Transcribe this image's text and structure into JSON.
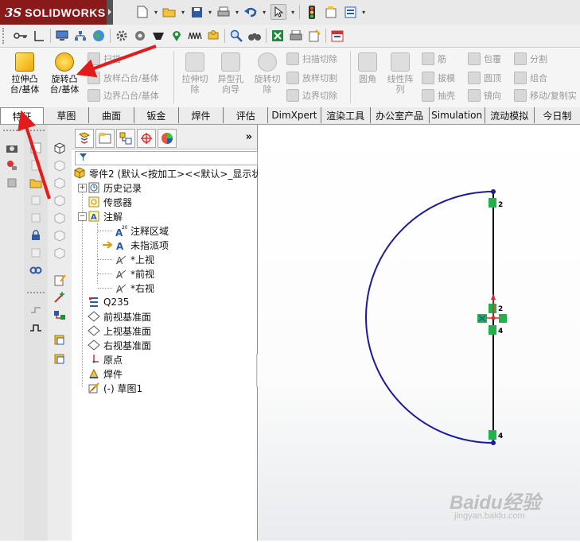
{
  "app": {
    "brand_prefix": "3S",
    "brand": "SOLIDWORKS"
  },
  "quick_access": [
    {
      "icon": "new-document-icon"
    },
    {
      "icon": "open-folder-icon"
    },
    {
      "icon": "save-icon"
    },
    {
      "icon": "print-icon"
    },
    {
      "icon": "undo-icon"
    },
    {
      "icon": "select-arrow-icon"
    },
    {
      "icon": "rebuild-traffic-light-icon"
    },
    {
      "icon": "file-properties-icon"
    },
    {
      "icon": "options-icon"
    }
  ],
  "ribbon": {
    "extrude_boss": "拉伸凸\n台/基体",
    "revolve_boss": "旋转凸\n台/基体",
    "sweep": "扫描",
    "loft_boss": "放样凸台/基体",
    "boundary_boss": "边界凸台/基体",
    "extrude_cut": "拉伸切\n除",
    "hole_wizard": "异型孔\n向导",
    "revolve_cut": "旋转切\n除",
    "sweep_cut": "扫描切除",
    "loft_cut": "放样切割",
    "boundary_cut": "边界切除",
    "fillet": "圆角",
    "linear_pattern": "线性阵\n列",
    "rib": "筋",
    "draft": "拔模",
    "shell": "抽壳",
    "wrap": "包覆",
    "dome": "圆顶",
    "mirror": "镜向",
    "split": "分割",
    "combine": "组合",
    "move_copy": "移动/复制实"
  },
  "tabs": [
    "特征",
    "草图",
    "曲面",
    "钣金",
    "焊件",
    "评估",
    "DimXpert",
    "渲染工具",
    "办公室产品",
    "Simulation",
    "流动模拟",
    "今日制"
  ],
  "tree": {
    "root": "零件2 (默认<按加工><<默认>_显示状",
    "history": "历史记录",
    "sensors": "传感器",
    "annotations": "注解",
    "annotation_area": "注释区域",
    "unassigned": "未指派项",
    "top_view": "*上视",
    "front_view": "*前视",
    "right_view": "*右视",
    "material": "Q235",
    "front_plane": "前视基准面",
    "top_plane": "上视基准面",
    "right_plane": "右视基准面",
    "origin": "原点",
    "weldment": "焊件",
    "sketch1": "(-) 草图1"
  },
  "sketch": {
    "relation_labels": [
      "2",
      "2",
      "4",
      "4"
    ],
    "arc_color": "#1a1a9e",
    "line_color": "#000000",
    "relation_color": "#22b14c"
  },
  "watermark": {
    "logo": "Baidu经验",
    "sub": "jingyan.baidu.com"
  }
}
